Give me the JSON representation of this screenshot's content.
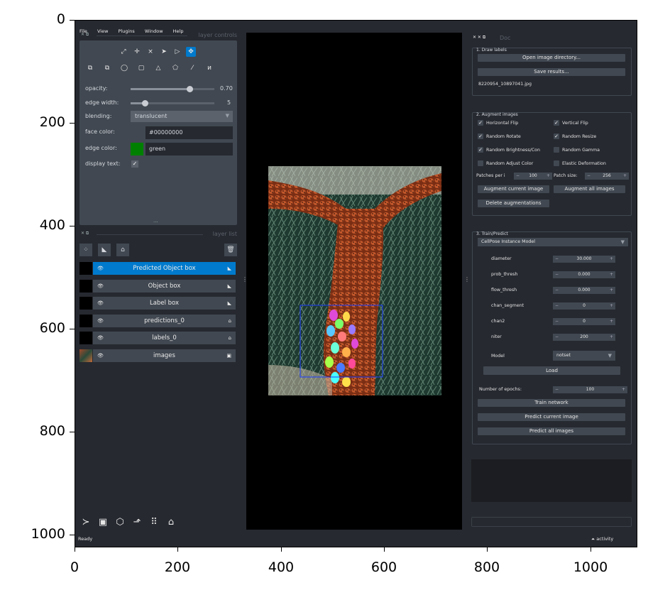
{
  "axes": {
    "y_ticks": [
      "0",
      "200",
      "400",
      "600",
      "800",
      "1000"
    ],
    "x_ticks": [
      "0",
      "200",
      "400",
      "600",
      "800",
      "1000"
    ]
  },
  "menu": [
    "File",
    "View",
    "Plugins",
    "Window",
    "Help"
  ],
  "layer_controls": {
    "title": "layer controls",
    "opacity_label": "opacity:",
    "opacity_value": "0.70",
    "opacity_fraction": 0.7,
    "edge_width_label": "edge width:",
    "edge_width_value": "5",
    "blending_label": "blending:",
    "blending_value": "translucent",
    "face_color_label": "face color:",
    "face_color_value": "#00000000",
    "edge_color_label": "edge color:",
    "edge_color_value": "green",
    "edge_color_swatch": "#008000",
    "display_text_label": "display text:",
    "tools": [
      "select-vertices-icon",
      "add-vertices-icon",
      "remove-vertices-icon",
      "select-icon",
      "direct-select-icon",
      "pan-zoom-icon",
      "move-back-icon",
      "move-front-icon",
      "ellipse-icon",
      "rectangle-icon",
      "polygon-icon",
      "path-icon",
      "line-icon",
      "polyline-icon"
    ]
  },
  "layer_list": {
    "title": "layer list",
    "layers": [
      {
        "name": "Predicted Object box",
        "selected": true,
        "icon": "shapes-icon"
      },
      {
        "name": "Object box",
        "selected": false,
        "icon": "shapes-icon"
      },
      {
        "name": "Label box",
        "selected": false,
        "icon": "shapes-icon"
      },
      {
        "name": "predictions_0",
        "selected": false,
        "icon": "labels-icon"
      },
      {
        "name": "labels_0",
        "selected": false,
        "icon": "labels-icon"
      },
      {
        "name": "images",
        "selected": false,
        "icon": "image-icon"
      }
    ]
  },
  "bottom_tools": [
    "console-icon",
    "ndisplay-icon",
    "roll-icon",
    "transpose-icon",
    "grid-icon",
    "home-icon"
  ],
  "status": {
    "left": "Ready",
    "right": "activity"
  },
  "dock": {
    "title": "Doc",
    "draw_labels": {
      "title": "1. Draw labels",
      "open_btn": "Open image directory...",
      "save_btn": "Save results...",
      "file": "8220954_10897041.jpg"
    },
    "augment": {
      "title": "2. Augment images",
      "checks": [
        {
          "label": "Horizontal Flip",
          "checked": true
        },
        {
          "label": "Vertical Flip",
          "checked": true
        },
        {
          "label": "Random Rotate",
          "checked": true
        },
        {
          "label": "Random Resize",
          "checked": true
        },
        {
          "label": "Random Brightness/Con",
          "checked": true
        },
        {
          "label": "Random Gamma",
          "checked": false
        },
        {
          "label": "Random Adjust Color",
          "checked": false
        },
        {
          "label": "Elastic Deformation",
          "checked": false
        }
      ],
      "patches_label": "Patches per i",
      "patches_value": "100",
      "patch_size_label": "Patch size:",
      "patch_size_value": "256",
      "aug_current": "Augment current image",
      "aug_all": "Augment all images",
      "delete": "Delete augmentations"
    },
    "train": {
      "title": "3. Train/Predict",
      "model_select": "CellPose Instance Model",
      "params": [
        {
          "label": "diameter",
          "value": "30.000"
        },
        {
          "label": "prob_thresh",
          "value": "0.000"
        },
        {
          "label": "flow_thresh",
          "value": "0.000"
        },
        {
          "label": "chan_segment",
          "value": "0"
        },
        {
          "label": "chan2",
          "value": "0"
        },
        {
          "label": "niter",
          "value": "200"
        }
      ],
      "model_label": "Model",
      "model_value": "notset",
      "load_btn": "Load",
      "epochs_label": "Number of epochs:",
      "epochs_value": "100",
      "train_btn": "Train network",
      "predict_current": "Predict current image",
      "predict_all": "Predict all images"
    }
  }
}
